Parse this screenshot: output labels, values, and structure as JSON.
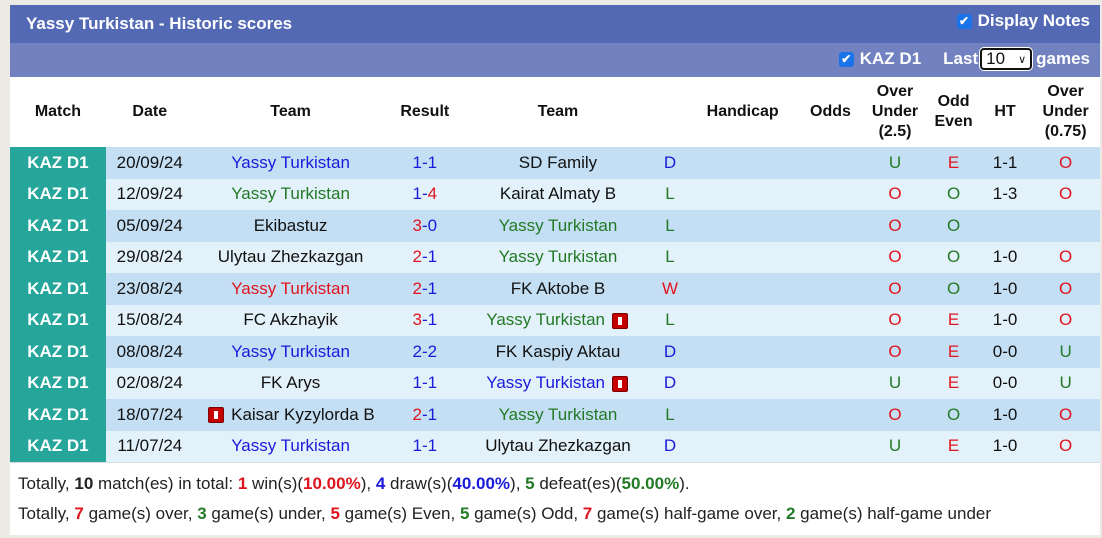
{
  "header": {
    "title": "Yassy Turkistan - Historic scores",
    "display_notes_label": "Display Notes",
    "display_notes_checked": true
  },
  "filter": {
    "league_label": "KAZ D1",
    "league_checked": true,
    "last_label": "Last",
    "games_select_value": "10",
    "games_label": "games"
  },
  "columns": [
    "Match",
    "Date",
    "Team",
    "Result",
    "Team",
    "Handicap",
    "Odds",
    "Over Under (2.5)",
    "Odd Even",
    "HT",
    "Over Under (0.75)"
  ],
  "colors": {
    "title_bg": "#5469b3",
    "filter_bg": "#7282c0",
    "league_bg": "#26a69a",
    "row_dark": "#c4dff3",
    "row_light": "#e3f1fa",
    "blue": "#1a1adb",
    "green": "#237a26",
    "red": "#e0141e"
  },
  "rows": [
    {
      "league": "KAZ D1",
      "date": "20/09/24",
      "home": "Yassy Turkistan",
      "home_color": "blue",
      "home_card": false,
      "score_home": "1",
      "score_home_color": "blue",
      "score_away": "1",
      "score_away_color": "blue",
      "away": "SD Family",
      "away_color": "black",
      "away_card": false,
      "outcome": "D",
      "outcome_color": "blue",
      "handicap": "",
      "odds": "",
      "ou": "U",
      "ou_color": "green",
      "oe": "E",
      "oe_color": "red",
      "ht": "1-1",
      "ou075": "O",
      "ou075_color": "red"
    },
    {
      "league": "KAZ D1",
      "date": "12/09/24",
      "home": "Yassy Turkistan",
      "home_color": "green",
      "home_card": false,
      "score_home": "1",
      "score_home_color": "blue",
      "score_away": "4",
      "score_away_color": "red",
      "away": "Kairat Almaty B",
      "away_color": "black",
      "away_card": false,
      "outcome": "L",
      "outcome_color": "green",
      "handicap": "",
      "odds": "",
      "ou": "O",
      "ou_color": "red",
      "oe": "O",
      "oe_color": "green",
      "ht": "1-3",
      "ou075": "O",
      "ou075_color": "red"
    },
    {
      "league": "KAZ D1",
      "date": "05/09/24",
      "home": "Ekibastuz",
      "home_color": "black",
      "home_card": false,
      "score_home": "3",
      "score_home_color": "red",
      "score_away": "0",
      "score_away_color": "blue",
      "away": "Yassy Turkistan",
      "away_color": "green",
      "away_card": false,
      "outcome": "L",
      "outcome_color": "green",
      "handicap": "",
      "odds": "",
      "ou": "O",
      "ou_color": "red",
      "oe": "O",
      "oe_color": "green",
      "ht": "",
      "ou075": "",
      "ou075_color": "red"
    },
    {
      "league": "KAZ D1",
      "date": "29/08/24",
      "home": "Ulytau Zhezkazgan",
      "home_color": "black",
      "home_card": false,
      "score_home": "2",
      "score_home_color": "red",
      "score_away": "1",
      "score_away_color": "blue",
      "away": "Yassy Turkistan",
      "away_color": "green",
      "away_card": false,
      "outcome": "L",
      "outcome_color": "green",
      "handicap": "",
      "odds": "",
      "ou": "O",
      "ou_color": "red",
      "oe": "O",
      "oe_color": "green",
      "ht": "1-0",
      "ou075": "O",
      "ou075_color": "red"
    },
    {
      "league": "KAZ D1",
      "date": "23/08/24",
      "home": "Yassy Turkistan",
      "home_color": "red",
      "home_card": false,
      "score_home": "2",
      "score_home_color": "red",
      "score_away": "1",
      "score_away_color": "blue",
      "away": "FK Aktobe B",
      "away_color": "black",
      "away_card": false,
      "outcome": "W",
      "outcome_color": "red",
      "handicap": "",
      "odds": "",
      "ou": "O",
      "ou_color": "red",
      "oe": "O",
      "oe_color": "green",
      "ht": "1-0",
      "ou075": "O",
      "ou075_color": "red"
    },
    {
      "league": "KAZ D1",
      "date": "15/08/24",
      "home": "FC Akzhayik",
      "home_color": "black",
      "home_card": false,
      "score_home": "3",
      "score_home_color": "red",
      "score_away": "1",
      "score_away_color": "blue",
      "away": "Yassy Turkistan",
      "away_color": "green",
      "away_card": true,
      "outcome": "L",
      "outcome_color": "green",
      "handicap": "",
      "odds": "",
      "ou": "O",
      "ou_color": "red",
      "oe": "E",
      "oe_color": "red",
      "ht": "1-0",
      "ou075": "O",
      "ou075_color": "red"
    },
    {
      "league": "KAZ D1",
      "date": "08/08/24",
      "home": "Yassy Turkistan",
      "home_color": "blue",
      "home_card": false,
      "score_home": "2",
      "score_home_color": "blue",
      "score_away": "2",
      "score_away_color": "blue",
      "away": "FK Kaspiy Aktau",
      "away_color": "black",
      "away_card": false,
      "outcome": "D",
      "outcome_color": "blue",
      "handicap": "",
      "odds": "",
      "ou": "O",
      "ou_color": "red",
      "oe": "E",
      "oe_color": "red",
      "ht": "0-0",
      "ou075": "U",
      "ou075_color": "green"
    },
    {
      "league": "KAZ D1",
      "date": "02/08/24",
      "home": "FK Arys",
      "home_color": "black",
      "home_card": false,
      "score_home": "1",
      "score_home_color": "blue",
      "score_away": "1",
      "score_away_color": "blue",
      "away": "Yassy Turkistan",
      "away_color": "blue",
      "away_card": true,
      "outcome": "D",
      "outcome_color": "blue",
      "handicap": "",
      "odds": "",
      "ou": "U",
      "ou_color": "green",
      "oe": "E",
      "oe_color": "red",
      "ht": "0-0",
      "ou075": "U",
      "ou075_color": "green"
    },
    {
      "league": "KAZ D1",
      "date": "18/07/24",
      "home": "Kaisar Kyzylorda B",
      "home_color": "black",
      "home_card": true,
      "score_home": "2",
      "score_home_color": "red",
      "score_away": "1",
      "score_away_color": "blue",
      "away": "Yassy Turkistan",
      "away_color": "green",
      "away_card": false,
      "outcome": "L",
      "outcome_color": "green",
      "handicap": "",
      "odds": "",
      "ou": "O",
      "ou_color": "red",
      "oe": "O",
      "oe_color": "green",
      "ht": "1-0",
      "ou075": "O",
      "ou075_color": "red"
    },
    {
      "league": "KAZ D1",
      "date": "11/07/24",
      "home": "Yassy Turkistan",
      "home_color": "blue",
      "home_card": false,
      "score_home": "1",
      "score_home_color": "blue",
      "score_away": "1",
      "score_away_color": "blue",
      "away": "Ulytau Zhezkazgan",
      "away_color": "black",
      "away_card": false,
      "outcome": "D",
      "outcome_color": "blue",
      "handicap": "",
      "odds": "",
      "ou": "U",
      "ou_color": "green",
      "oe": "E",
      "oe_color": "red",
      "ht": "1-0",
      "ou075": "O",
      "ou075_color": "red"
    }
  ],
  "summary": {
    "line1": [
      {
        "t": "Totally, ",
        "c": ""
      },
      {
        "t": "10",
        "c": "bold"
      },
      {
        "t": " match(es) in total: ",
        "c": ""
      },
      {
        "t": "1",
        "c": "red"
      },
      {
        "t": " win(s)(",
        "c": ""
      },
      {
        "t": "10.00%",
        "c": "red"
      },
      {
        "t": "), ",
        "c": ""
      },
      {
        "t": "4",
        "c": "blue"
      },
      {
        "t": " draw(s)(",
        "c": ""
      },
      {
        "t": "40.00%",
        "c": "blue"
      },
      {
        "t": "), ",
        "c": ""
      },
      {
        "t": "5",
        "c": "green"
      },
      {
        "t": " defeat(es)(",
        "c": ""
      },
      {
        "t": "50.00%",
        "c": "green"
      },
      {
        "t": ").",
        "c": ""
      }
    ],
    "line2": [
      {
        "t": "Totally, ",
        "c": ""
      },
      {
        "t": "7",
        "c": "red"
      },
      {
        "t": " game(s) over, ",
        "c": ""
      },
      {
        "t": "3",
        "c": "green"
      },
      {
        "t": " game(s) under, ",
        "c": ""
      },
      {
        "t": "5",
        "c": "red"
      },
      {
        "t": " game(s) Even, ",
        "c": ""
      },
      {
        "t": "5",
        "c": "green"
      },
      {
        "t": " game(s) Odd, ",
        "c": ""
      },
      {
        "t": "7",
        "c": "red"
      },
      {
        "t": " game(s) half-game over, ",
        "c": ""
      },
      {
        "t": "2",
        "c": "green"
      },
      {
        "t": " game(s) half-game under",
        "c": ""
      }
    ]
  }
}
